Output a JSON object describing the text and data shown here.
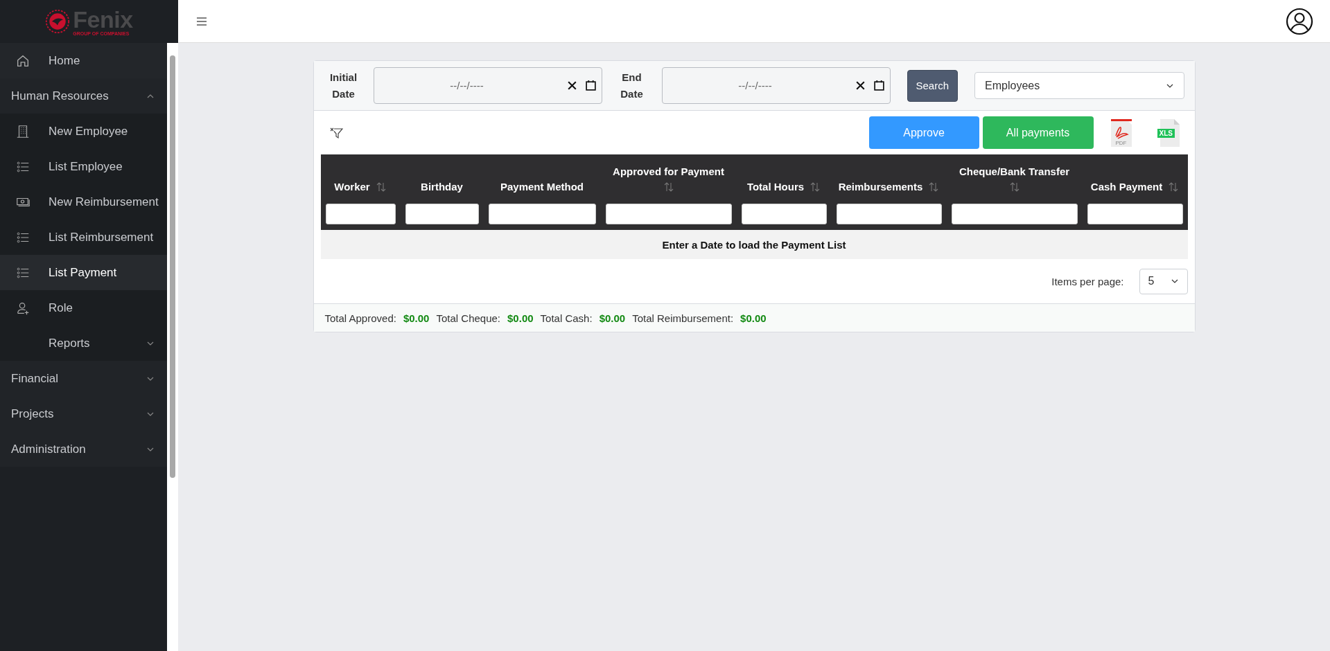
{
  "logo": {
    "name": "Fenix",
    "tagline": "GROUP OF COMPANIES"
  },
  "sidebar": {
    "items": [
      {
        "label": "Home",
        "kind": "link",
        "selected": false
      },
      {
        "label": "Human Resources",
        "kind": "group",
        "expanded": true,
        "children": [
          {
            "label": "New Employee",
            "kind": "link",
            "selected": false
          },
          {
            "label": "List Employee",
            "kind": "link",
            "selected": false
          },
          {
            "label": "New Reimbursement",
            "kind": "link",
            "selected": false
          },
          {
            "label": "List Reimbursement",
            "kind": "link",
            "selected": false
          },
          {
            "label": "List Payment",
            "kind": "link",
            "selected": true
          },
          {
            "label": "Role",
            "kind": "link",
            "selected": false
          },
          {
            "label": "Reports",
            "kind": "group",
            "expanded": false
          }
        ]
      },
      {
        "label": "Financial",
        "kind": "group",
        "expanded": false
      },
      {
        "label": "Projects",
        "kind": "group",
        "expanded": false
      },
      {
        "label": "Administration",
        "kind": "group",
        "expanded": false
      }
    ]
  },
  "filters": {
    "initial_date": {
      "label": "Initial Date",
      "placeholder": "--/--/----"
    },
    "end_date": {
      "label": "End Date",
      "placeholder": "--/--/----"
    },
    "search_button": "Search",
    "type_select": {
      "value": "Employees"
    }
  },
  "actions": {
    "approve": "Approve",
    "all_payments": "All payments",
    "pdf_label": "PDF",
    "xls_label": "XLS"
  },
  "table": {
    "columns": [
      {
        "label": "Worker",
        "sortable": true
      },
      {
        "label": "Birthday",
        "sortable": false
      },
      {
        "label": "Payment Method",
        "sortable": false
      },
      {
        "label": "Approved for Payment",
        "sortable": true
      },
      {
        "label": "Total Hours",
        "sortable": true
      },
      {
        "label": "Reimbursements",
        "sortable": true
      },
      {
        "label": "Cheque/Bank Transfer",
        "sortable": true
      },
      {
        "label": "Cash Payment",
        "sortable": true
      }
    ],
    "empty_message": "Enter a Date to load the Payment List"
  },
  "pager": {
    "label": "Items per page:",
    "value": "5"
  },
  "totals": [
    {
      "label": "Total Approved:",
      "value": "$0.00"
    },
    {
      "label": "Total Cheque:",
      "value": "$0.00"
    },
    {
      "label": "Total Cash:",
      "value": "$0.00"
    },
    {
      "label": "Total Reimbursement:",
      "value": "$0.00"
    }
  ]
}
